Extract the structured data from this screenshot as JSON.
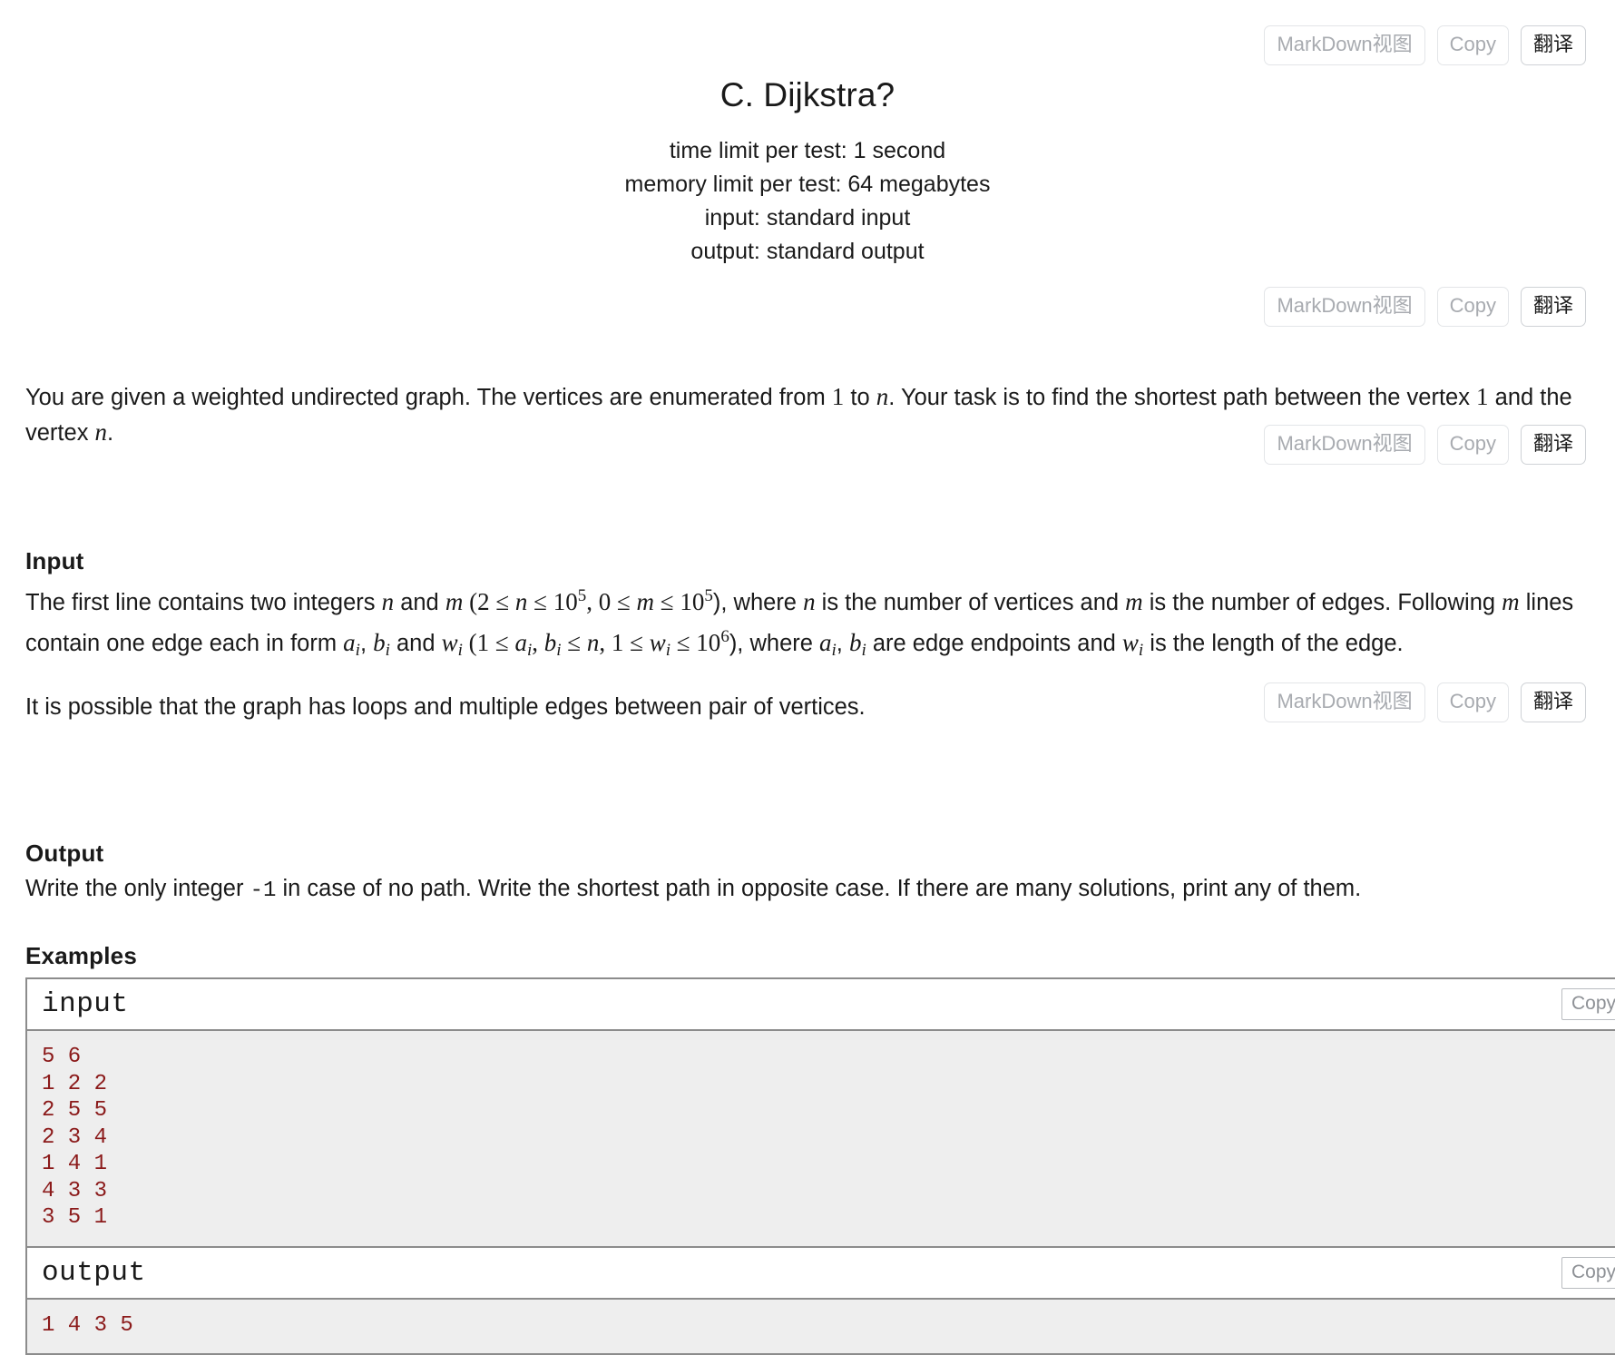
{
  "toolbar": {
    "markdown_label": "MarkDown视图",
    "copy_label": "Copy",
    "translate_label": "翻译"
  },
  "problem": {
    "title": "C. Dijkstra?",
    "time_limit": "time limit per test: 1 second",
    "memory_limit": "memory limit per test: 64 megabytes",
    "input_spec": "input: standard input",
    "output_spec": "output: standard output"
  },
  "statement": {
    "p1_a": "You are given a weighted undirected graph. The vertices are enumerated from ",
    "p1_one": "1",
    "p1_b": " to ",
    "p1_n": "n",
    "p1_c": ". Your task is to find the shortest path between the vertex ",
    "p1_one2": "1",
    "p1_d": " and the vertex ",
    "p1_n2": "n",
    "p1_e": "."
  },
  "input_section": {
    "heading": "Input",
    "l1_a": "The first line contains two integers ",
    "l1_n": "n",
    "l1_b": " and ",
    "l1_m": "m",
    "l1_c": " (2 ≤ ",
    "l1_n2": "n",
    "l1_d": " ≤ 10",
    "l1_sup1": "5",
    "l1_e": ", 0 ≤ ",
    "l1_m2": "m",
    "l1_f": " ≤ 10",
    "l1_sup2": "5",
    "l1_g": "), where ",
    "l1_n3": "n",
    "l1_h": " is the number of vertices and ",
    "l1_m3": "m",
    "l1_i": " is the number of edges.",
    "l2_a": "Following ",
    "l2_m": "m",
    "l2_b": " lines contain one edge each in form ",
    "l2_a_i": "a",
    "l2_a_i_sub": "i",
    "l2_c": ", ",
    "l2_b_i": "b",
    "l2_b_i_sub": "i",
    "l2_d": " and ",
    "l2_w_i": "w",
    "l2_w_i_sub": "i",
    "l2_e": " (1 ≤ ",
    "l2_a_i2": "a",
    "l2_a_i2_sub": "i",
    "l2_f": ", ",
    "l2_b_i2": "b",
    "l2_b_i2_sub": "i",
    "l2_g": " ≤ ",
    "l2_n": "n",
    "l2_h": ", 1 ≤ ",
    "l2_w_i2": "w",
    "l2_w_i2_sub": "i",
    "l2_i": " ≤ 10",
    "l2_sup": "6",
    "l2_j": "), where ",
    "l2_a_i3": "a",
    "l2_a_i3_sub": "i",
    "l2_k": ", ",
    "l2_b_i3": "b",
    "l2_b_i3_sub": "i",
    "l2_l": " are edge endpoints and ",
    "l2_w_i3": "w",
    "l2_w_i3_sub": "i",
    "l2_m_txt": " is the length of the edge.",
    "p_loops": "It is possible that the graph has loops and multiple edges between pair of vertices."
  },
  "output_section": {
    "heading": "Output",
    "t_a": "Write the only integer ",
    "t_code": "-1",
    "t_b": " in case of no path. Write the shortest path in opposite case. If there are many solutions, print any of them."
  },
  "examples_section": {
    "heading": "Examples",
    "input_label": "input",
    "output_label": "output",
    "copy_label": "Copy",
    "input_text": "5 6\n1 2 2\n2 5 5\n2 3 4\n1 4 1\n4 3 3\n3 5 1",
    "output_text": "1 4 3 5"
  },
  "colors": {
    "sample_text": "#8b1a1a",
    "sample_bg": "#eeeeee",
    "border": "#8c8c8c",
    "muted_btn_text": "#a8abb0"
  }
}
